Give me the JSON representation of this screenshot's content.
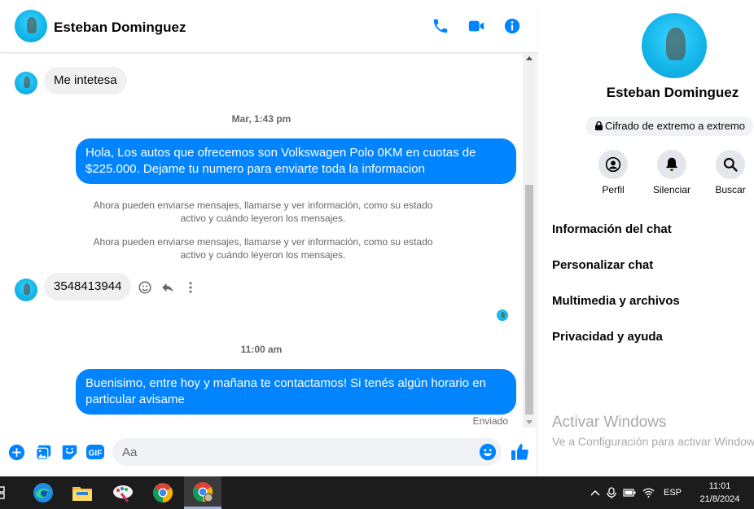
{
  "contact": {
    "name": "Esteban Dominguez"
  },
  "messages": [
    {
      "from": "them",
      "text": "Me intetesa"
    },
    {
      "type": "timestamp",
      "text": "Mar, 1:43 pm"
    },
    {
      "from": "me",
      "line1": "Hola, Los autos que ofrecemos son Volkswagen Polo 0KM en cuotas de",
      "line2": "$225.000. Dejame tu numero para enviarte toda la informacion"
    },
    {
      "type": "system",
      "line1": "Ahora pueden enviarse mensajes, llamarse y ver información, como su estado",
      "line2": "activo y cuándo leyeron los mensajes."
    },
    {
      "type": "system",
      "line1": "Ahora pueden enviarse mensajes, llamarse y ver información, como su estado",
      "line2": "activo y cuándo leyeron los mensajes."
    },
    {
      "from": "them",
      "text": "3548413944"
    },
    {
      "type": "timestamp",
      "text": "11:00 am"
    },
    {
      "from": "me",
      "line1": "Buenisimo, entre hoy y mañana te contactamos! Si tenés algún horario en",
      "line2": "particular avisame"
    }
  ],
  "status": {
    "sent": "Enviado"
  },
  "composer": {
    "placeholder": "Aa",
    "gif_label": "GIF"
  },
  "panel": {
    "name": "Esteban Dominguez",
    "encryption": "Cifrado de extremo a extremo",
    "actions": [
      {
        "label": "Perfil"
      },
      {
        "label": "Silenciar"
      },
      {
        "label": "Buscar"
      }
    ],
    "menu": [
      "Información del chat",
      "Personalizar chat",
      "Multimedia y archivos",
      "Privacidad y ayuda"
    ]
  },
  "watermark": {
    "title": "Activar Windows",
    "subtitle": "Ve a Configuración para activar Windows."
  },
  "taskbar": {
    "language": "ESP",
    "time": "11:01",
    "date": "21/8/2024"
  },
  "colors": {
    "accent": "#0084ff",
    "bubble_in": "#f0f0f0",
    "muted": "#65676b",
    "taskbar": "#1c1c1c"
  },
  "icons": {
    "header": [
      "phone-icon",
      "video-camera-icon",
      "info-icon"
    ],
    "composer": [
      "plus-circle-icon",
      "image-icon",
      "sticker-icon",
      "gif-icon",
      "emoji-icon",
      "thumbs-up-icon"
    ],
    "taskbar": [
      "task-view-icon",
      "edge-icon",
      "file-explorer-icon",
      "paint-icon",
      "chrome-icon",
      "chrome-profile-icon"
    ]
  }
}
